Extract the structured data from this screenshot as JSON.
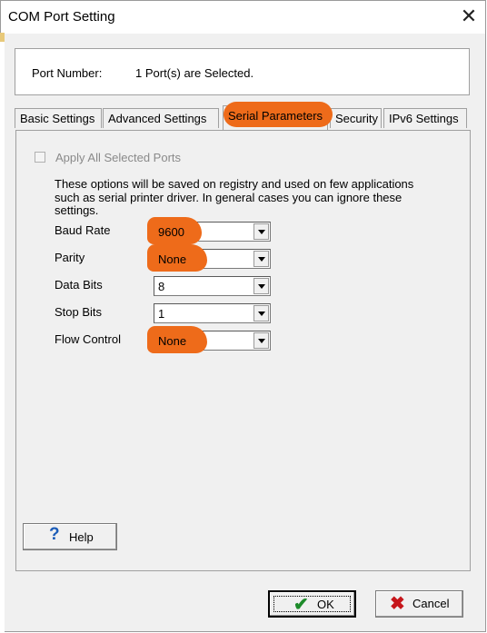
{
  "window": {
    "title": "COM Port Setting"
  },
  "port_info": {
    "label": "Port Number:",
    "value": "1 Port(s) are Selected."
  },
  "tabs": [
    {
      "label": "Basic Settings"
    },
    {
      "label": "Advanced Settings"
    },
    {
      "label": "Serial Parameters",
      "selected": true
    },
    {
      "label": "Security"
    },
    {
      "label": "IPv6 Settings"
    }
  ],
  "apply_all": {
    "label": "Apply All Selected Ports",
    "checked": false,
    "enabled": false
  },
  "description": "These options will be saved on registry and used on few applications such as serial printer driver. In general cases you can ignore these settings.",
  "fields": {
    "baud_rate": {
      "label": "Baud Rate",
      "value": "9600"
    },
    "parity": {
      "label": "Parity",
      "value": "None"
    },
    "data_bits": {
      "label": "Data Bits",
      "value": "8"
    },
    "stop_bits": {
      "label": "Stop Bits",
      "value": "1"
    },
    "flow_control": {
      "label": "Flow Control",
      "value": "None"
    }
  },
  "buttons": {
    "help": "Help",
    "ok": "OK",
    "cancel": "Cancel"
  },
  "highlight_color": "#ee6b1a"
}
